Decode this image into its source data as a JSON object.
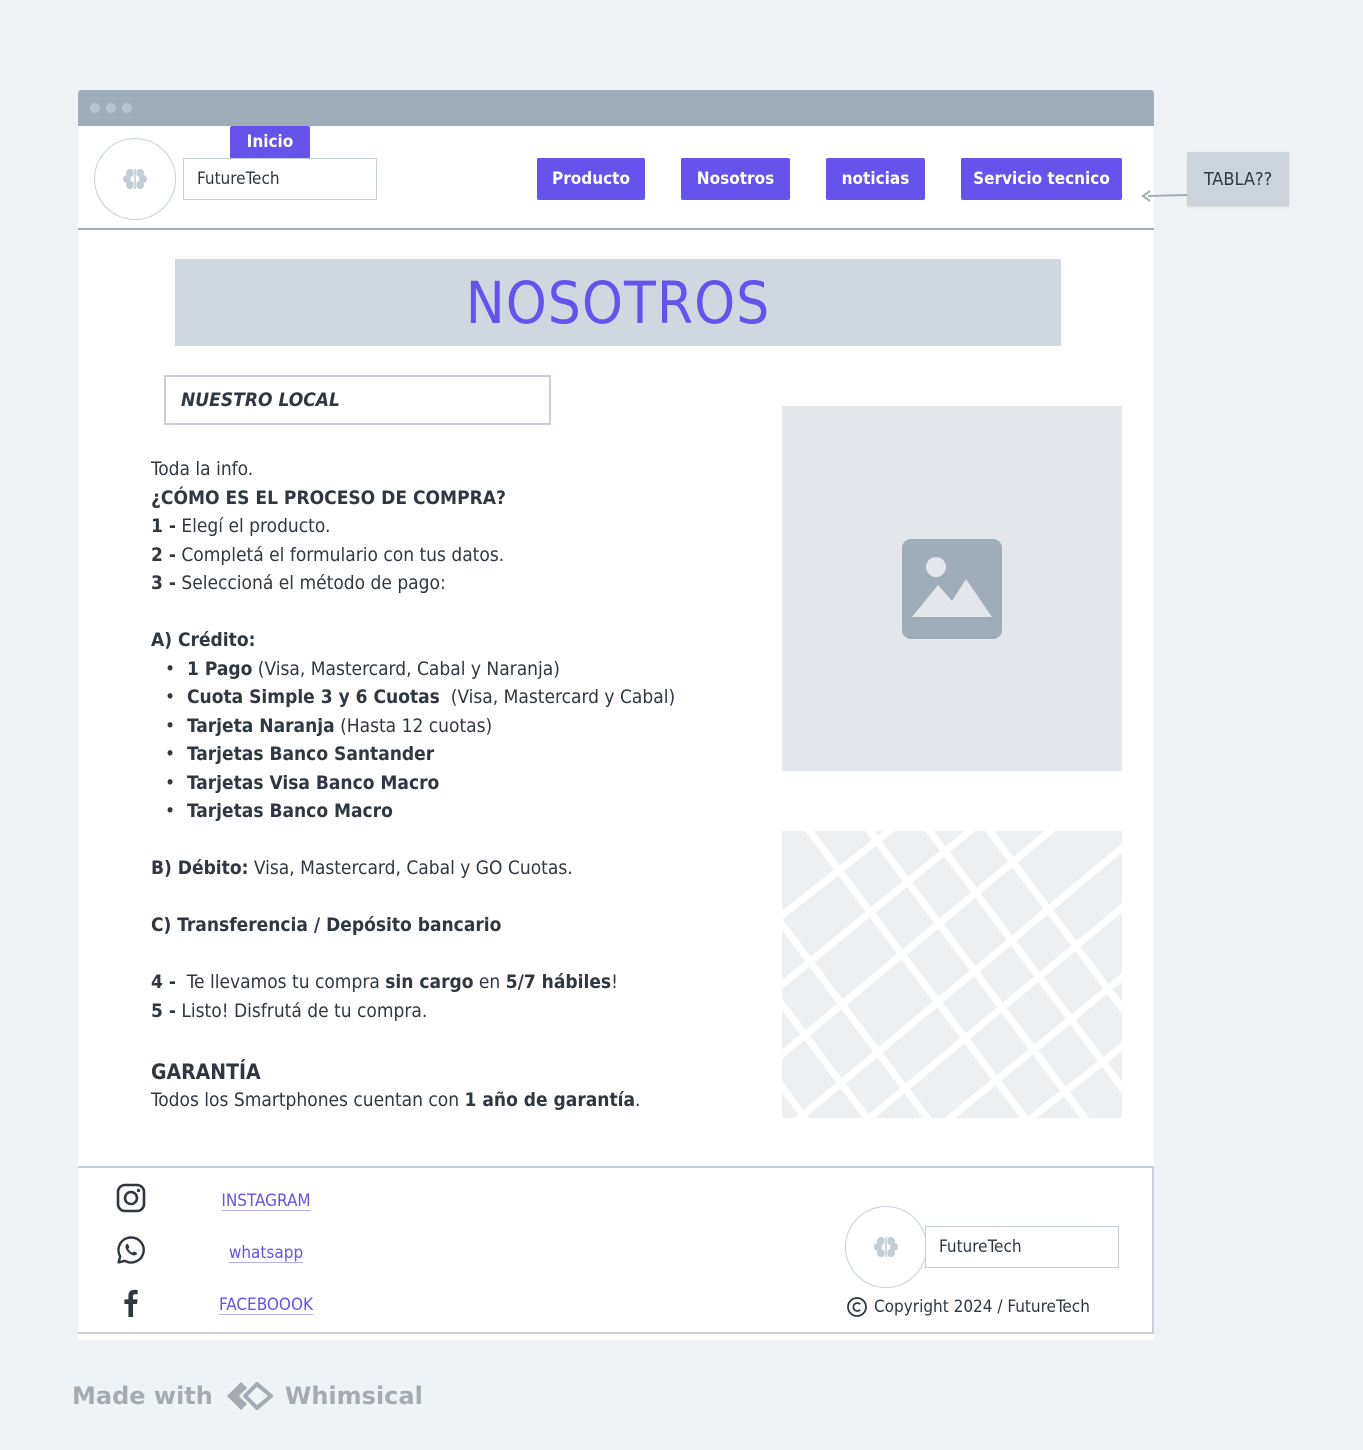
{
  "header": {
    "brand": "FutureTech",
    "inicio_label": "Inicio",
    "nav": [
      {
        "label": "Producto"
      },
      {
        "label": "Nosotros"
      },
      {
        "label": "noticias"
      },
      {
        "label": "Servicio tecnico"
      }
    ]
  },
  "annotation": {
    "text": "TABLA??"
  },
  "main": {
    "title": "NOSOTROS",
    "section_title": "NUESTRO LOCAL",
    "intro": "Toda la info.",
    "process_heading": "¿CÓMO ES EL PROCESO DE COMPRA?",
    "steps": [
      {
        "num": "1 -",
        "text": " Elegí el producto."
      },
      {
        "num": "2 -",
        "text": " Completá el formulario con tus datos."
      },
      {
        "num": "3 -",
        "text": " Seleccioná el método de pago:"
      }
    ],
    "credit": {
      "heading": "A) Crédito:",
      "items": [
        {
          "bold": "1 Pago",
          "rest": " (Visa, Mastercard, Cabal y Naranja)"
        },
        {
          "bold": "Cuota Simple 3 y 6 Cuotas",
          "rest": "  (Visa, Mastercard y Cabal)"
        },
        {
          "bold": "Tarjeta Naranja",
          "rest": " (Hasta 12 cuotas)"
        },
        {
          "bold": "Tarjetas Banco Santander",
          "rest": ""
        },
        {
          "bold": "Tarjetas Visa Banco Macro",
          "rest": ""
        },
        {
          "bold": "Tarjetas Banco Macro",
          "rest": ""
        }
      ]
    },
    "debit": {
      "heading": "B) Débito:",
      "text": " Visa, Mastercard, Cabal y GO Cuotas."
    },
    "transfer": {
      "heading": "C) Transferencia / Depósito bancario"
    },
    "step4": {
      "num": "4 -",
      "t1": "  Te llevamos tu compra ",
      "b1": "sin cargo",
      "t2": " en ",
      "b2": "5/7 hábiles",
      "t3": "!"
    },
    "step5": {
      "num": "5 -",
      "text": " Listo! Disfrutá de tu compra."
    },
    "warranty": {
      "heading": "GARANTÍA",
      "t1": "Todos los Smartphones cuentan con ",
      "b1": "1 año de garantía",
      "t2": "."
    },
    "image_icon": "image-icon",
    "map_icon": "map-placeholder"
  },
  "footer": {
    "social": [
      {
        "icon": "instagram-icon",
        "label": "INSTAGRAM"
      },
      {
        "icon": "whatsapp-icon",
        "label": "whatsapp"
      },
      {
        "icon": "facebook-icon",
        "label": "FACEBOOOK"
      }
    ],
    "brand": "FutureTech",
    "copyright": "Copyright 2024 / FutureTech"
  },
  "watermark": {
    "made_with": "Made with",
    "brand": "Whimsical"
  },
  "colors": {
    "accent": "#6553ec",
    "titlebar": "#9fadb9",
    "banner": "#cfd8e0",
    "text": "#2f3742"
  }
}
